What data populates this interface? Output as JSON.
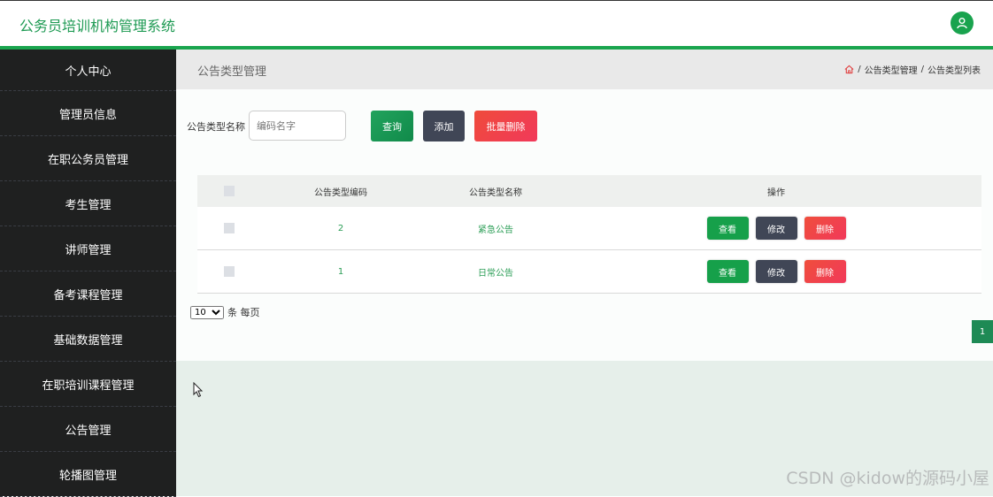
{
  "header": {
    "title": "公务员培训机构管理系统"
  },
  "sidebar": {
    "items": [
      {
        "label": "个人中心"
      },
      {
        "label": "管理员信息"
      },
      {
        "label": "在职公务员管理"
      },
      {
        "label": "考生管理"
      },
      {
        "label": "讲师管理"
      },
      {
        "label": "备考课程管理"
      },
      {
        "label": "基础数据管理"
      },
      {
        "label": "在职培训课程管理"
      },
      {
        "label": "公告管理"
      },
      {
        "label": "轮播图管理"
      }
    ]
  },
  "breadcrumb": {
    "page_title": "公告类型管理",
    "separator": "/",
    "level1": "公告类型管理",
    "level2": "公告类型列表"
  },
  "search": {
    "label": "公告类型名称",
    "placeholder": "编码名字",
    "value": "",
    "query_label": "查询",
    "add_label": "添加",
    "batch_delete_label": "批量删除"
  },
  "table": {
    "headers": {
      "code": "公告类型编码",
      "name": "公告类型名称",
      "ops": "操作"
    },
    "rows": [
      {
        "code": "2",
        "name": "紧急公告",
        "view": "查看",
        "edit": "修改",
        "del": "删除"
      },
      {
        "code": "1",
        "name": "日常公告",
        "view": "查看",
        "edit": "修改",
        "del": "删除"
      }
    ]
  },
  "pagination": {
    "page_size": "10",
    "per_page_label": "条 每页",
    "current_page": "1"
  },
  "watermark": "CSDN @kidow的源码小屋",
  "colors": {
    "accent": "#1aa54e",
    "dark_button": "#404656",
    "danger": "#f1395a",
    "sidebar_bg": "#1f2020"
  }
}
